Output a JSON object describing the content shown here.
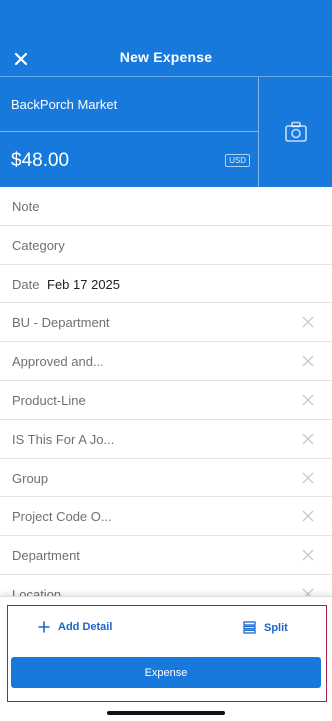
{
  "header": {
    "title": "New Expense",
    "close_icon": "close-icon",
    "merchant": "BackPorch Market",
    "amount": "$48.00",
    "currency": "USD",
    "camera_icon": "camera-icon"
  },
  "fields": [
    {
      "label": "Note",
      "value": "",
      "clearable": false
    },
    {
      "label": "Category",
      "value": "",
      "clearable": false
    },
    {
      "label": "Date",
      "value": "Feb 17 2025",
      "clearable": false
    },
    {
      "label": "BU - Department",
      "value": "",
      "clearable": true
    },
    {
      "label": "Approved and...",
      "value": "",
      "clearable": true
    },
    {
      "label": "Product-Line",
      "value": "",
      "clearable": true
    },
    {
      "label": "IS This For A Jo...",
      "value": "",
      "clearable": true
    },
    {
      "label": "Group",
      "value": "",
      "clearable": true
    },
    {
      "label": "Project Code O...",
      "value": "",
      "clearable": true
    },
    {
      "label": "Department",
      "value": "",
      "clearable": true
    },
    {
      "label": "Location",
      "value": "",
      "clearable": true
    }
  ],
  "footer": {
    "add_detail": "Add Detail",
    "split": "Split",
    "expense": "Expense"
  },
  "colors": {
    "brand_blue": "#1879dc",
    "link_blue": "#1a66c9",
    "highlight": "#a1204e"
  }
}
